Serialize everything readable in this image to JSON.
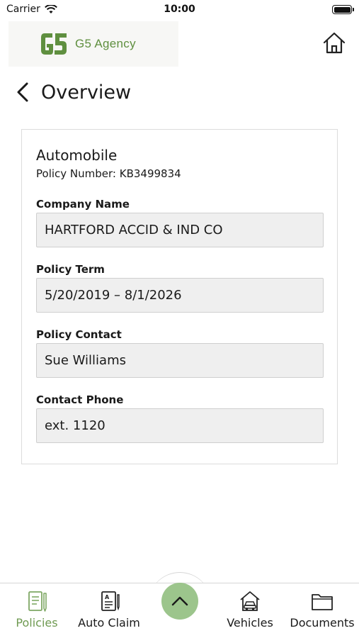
{
  "status_bar": {
    "carrier": "Carrier",
    "time": "10:00"
  },
  "header": {
    "brand": "G5 Agency",
    "brand_color": "#5f8f3f"
  },
  "page": {
    "title": "Overview"
  },
  "policy": {
    "type": "Automobile",
    "number_text": "Policy Number: KB3499834",
    "fields": [
      {
        "label": "Company Name",
        "value": "HARTFORD ACCID & IND CO"
      },
      {
        "label": "Policy Term",
        "value": "5/20/2019 – 8/1/2026"
      },
      {
        "label": "Policy Contact",
        "value": "Sue Williams"
      },
      {
        "label": "Contact Phone",
        "value": "ext. 1120"
      }
    ]
  },
  "tab_bar": {
    "tabs": [
      {
        "label": "Policies",
        "icon": "policies-icon",
        "active": true
      },
      {
        "label": "Auto Claim",
        "icon": "auto-claim-icon",
        "active": false
      },
      {
        "label": "Vehicles",
        "icon": "vehicles-icon",
        "active": false
      },
      {
        "label": "Documents",
        "icon": "documents-icon",
        "active": false
      }
    ],
    "center_button_icon": "chevron-up-icon",
    "accent": "#9cc58c",
    "active_color": "#6f9a52"
  }
}
